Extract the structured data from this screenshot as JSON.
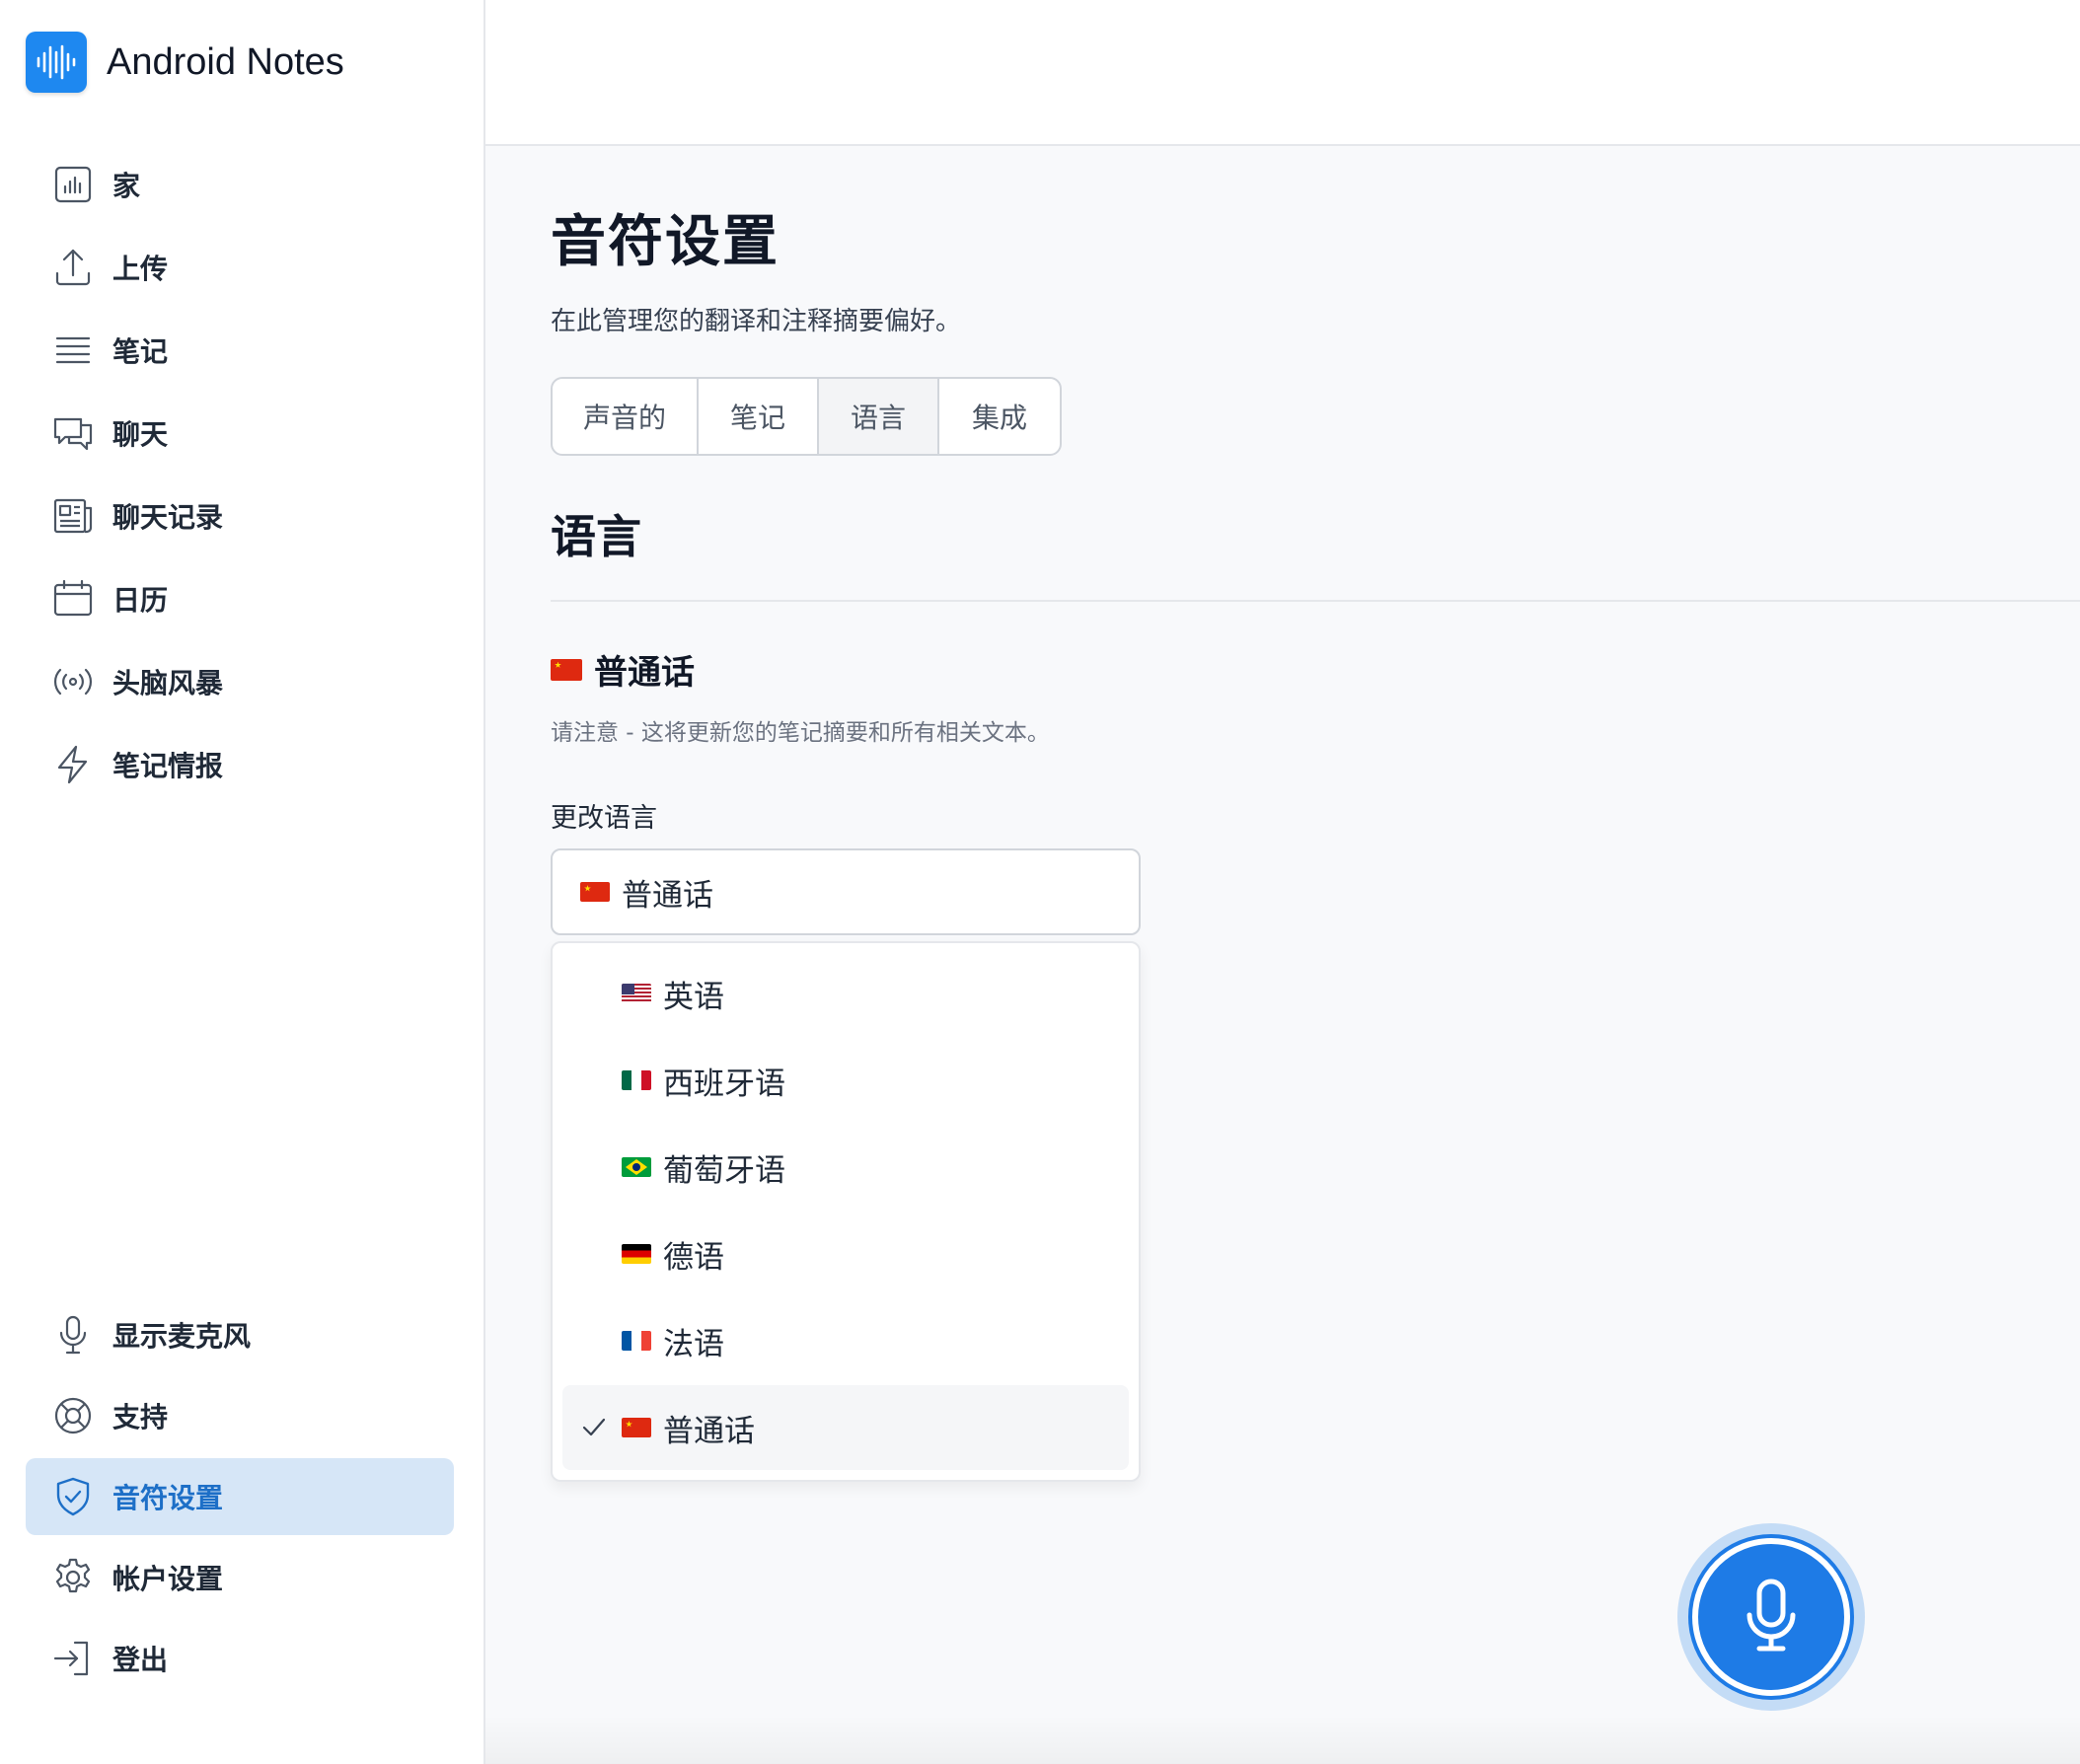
{
  "app": {
    "title": "Android Notes",
    "logo_icon": "waveform-icon",
    "brand_color": "#1e88f0"
  },
  "sidebar": {
    "items": [
      {
        "label": "家",
        "icon": "bar-chart-icon"
      },
      {
        "label": "上传",
        "icon": "upload-icon"
      },
      {
        "label": "笔记",
        "icon": "list-icon"
      },
      {
        "label": "聊天",
        "icon": "chat-bubbles-icon"
      },
      {
        "label": "聊天记录",
        "icon": "newspaper-icon"
      },
      {
        "label": "日历",
        "icon": "calendar-icon"
      },
      {
        "label": "头脑风暴",
        "icon": "broadcast-icon"
      },
      {
        "label": "笔记情报",
        "icon": "lightning-icon"
      }
    ],
    "bottom_items": [
      {
        "label": "显示麦克风",
        "icon": "microphone-icon"
      },
      {
        "label": "支持",
        "icon": "lifebuoy-icon"
      },
      {
        "label": "音符设置",
        "icon": "shield-check-icon",
        "active": true
      },
      {
        "label": "帐户设置",
        "icon": "gear-icon"
      },
      {
        "label": "登出",
        "icon": "sign-in-arrow-icon"
      }
    ],
    "active_color": "#1d6fc7"
  },
  "main": {
    "title": "音符设置",
    "subtitle": "在此管理您的翻译和注释摘要偏好。",
    "tabs": [
      {
        "label": "声音的"
      },
      {
        "label": "笔记"
      },
      {
        "label": "语言",
        "active": true
      },
      {
        "label": "集成"
      }
    ],
    "section_title": "语言",
    "current_language": {
      "flag": "cn-flag",
      "label": "普通话"
    },
    "note": "请注意 - 这将更新您的笔记摘要和所有相关文本。",
    "change_label": "更改语言",
    "select": {
      "value": "普通话",
      "flag": "cn-flag"
    },
    "options": [
      {
        "label": "英语",
        "flag": "us-flag"
      },
      {
        "label": "西班牙语",
        "flag": "mx-flag"
      },
      {
        "label": "葡萄牙语",
        "flag": "br-flag"
      },
      {
        "label": "德语",
        "flag": "de-flag"
      },
      {
        "label": "法语",
        "flag": "fr-flag"
      },
      {
        "label": "普通话",
        "flag": "cn-flag",
        "selected": true
      }
    ]
  },
  "mic_button": {
    "icon": "microphone-icon",
    "color": "#1e7be6"
  }
}
